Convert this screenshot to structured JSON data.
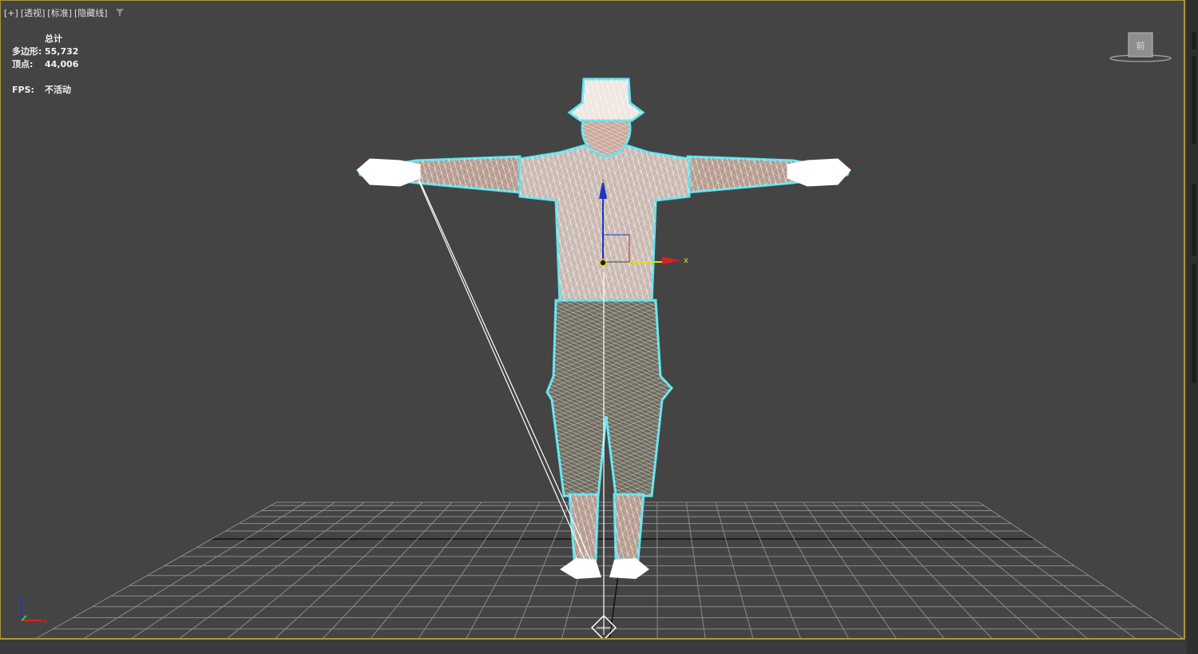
{
  "viewport": {
    "label_plus": "[+]",
    "label_view": "[透视]",
    "label_shading_standard": "[标准]",
    "label_shading_mode": "[隐藏线]",
    "filter_icon": "filter-icon",
    "border_color": "#a9973e",
    "background": "#444444"
  },
  "stats": {
    "header": "总计",
    "polygons_label": "多边形:",
    "polygons_value": "55,732",
    "vertices_label": "顶点:",
    "vertices_value": "44,006",
    "fps_label": "FPS:",
    "fps_value": "不活动"
  },
  "viewcube": {
    "face_label": "前",
    "icon": "viewcube-icon"
  },
  "gizmo": {
    "x_label": "x",
    "y_label": "y",
    "z_label": "z"
  },
  "tripod": {
    "z_label": "z",
    "x_label": "x"
  },
  "colors": {
    "selection": "#5fe3ef",
    "x_axis": "#e02020",
    "y_axis": "#e8e000",
    "z_axis": "#1c36c8",
    "grid": "#8a8a8a"
  }
}
